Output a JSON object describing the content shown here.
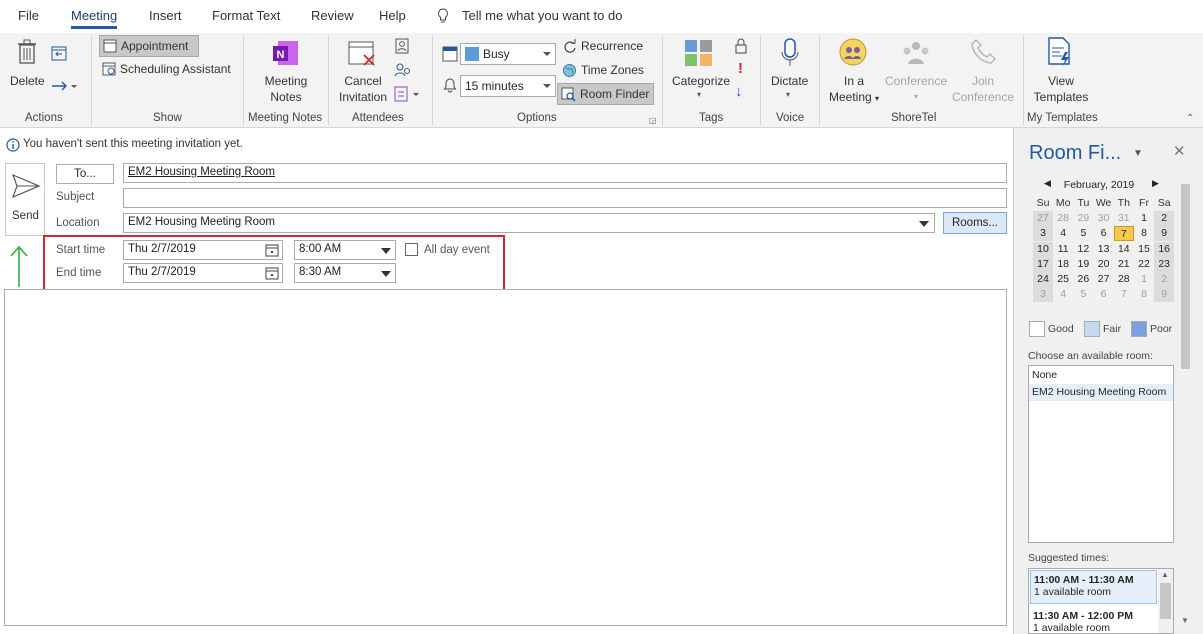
{
  "menu": {
    "tabs": [
      "File",
      "Meeting",
      "Insert",
      "Format Text",
      "Review",
      "Help"
    ],
    "active": "Meeting",
    "tell_me": "Tell me what you want to do"
  },
  "ribbon": {
    "actions": {
      "delete": "Delete",
      "group": "Actions"
    },
    "show": {
      "appointment": "Appointment",
      "scheduling": "Scheduling Assistant",
      "group": "Show"
    },
    "meeting_notes": {
      "line1": "Meeting",
      "line2": "Notes",
      "group": "Meeting Notes"
    },
    "attendees": {
      "line1": "Cancel",
      "line2": "Invitation",
      "group": "Attendees"
    },
    "options": {
      "show_as": "Busy",
      "reminder": "15 minutes",
      "recurrence": "Recurrence",
      "time_zones": "Time Zones",
      "room_finder": "Room Finder",
      "group": "Options"
    },
    "tags": {
      "categorize": "Categorize",
      "group": "Tags"
    },
    "voice": {
      "dictate": "Dictate",
      "group": "Voice"
    },
    "shoretel": {
      "in_a_1": "In a",
      "in_a_2": "Meeting",
      "conf_1": "Conference",
      "join_1": "Join",
      "join_2": "Conference",
      "group": "ShoreTel"
    },
    "templates": {
      "line1": "View",
      "line2": "Templates",
      "group": "My Templates"
    }
  },
  "form": {
    "info": "You haven't sent this meeting invitation yet.",
    "send": "Send",
    "to_button": "To...",
    "to_value": "EM2 Housing Meeting Room",
    "subject_label": "Subject",
    "subject_value": "",
    "location_label": "Location",
    "location_value": "EM2 Housing Meeting Room",
    "rooms_button": "Rooms...",
    "start_label": "Start time",
    "start_date": "Thu 2/7/2019",
    "start_time": "8:00 AM",
    "end_label": "End time",
    "end_date": "Thu 2/7/2019",
    "end_time": "8:30 AM",
    "all_day": "All day event"
  },
  "room_finder": {
    "title": "Room Fi...",
    "month": "February, 2019",
    "weekdays": [
      "Su",
      "Mo",
      "Tu",
      "We",
      "Th",
      "Fr",
      "Sa"
    ],
    "weeks": [
      [
        "27",
        "28",
        "29",
        "30",
        "31",
        "1",
        "2"
      ],
      [
        "3",
        "4",
        "5",
        "6",
        "7",
        "8",
        "9"
      ],
      [
        "10",
        "11",
        "12",
        "13",
        "14",
        "15",
        "16"
      ],
      [
        "17",
        "18",
        "19",
        "20",
        "21",
        "22",
        "23"
      ],
      [
        "24",
        "25",
        "26",
        "27",
        "28",
        "1",
        "2"
      ],
      [
        "3",
        "4",
        "5",
        "6",
        "7",
        "8",
        "9"
      ]
    ],
    "selected_day": "7",
    "legend": {
      "good": "Good",
      "fair": "Fair",
      "poor": "Poor"
    },
    "choose_label": "Choose an available room:",
    "rooms": [
      "None",
      "EM2 Housing Meeting Room"
    ],
    "suggested_label": "Suggested times:",
    "suggestions": [
      {
        "time": "11:00 AM - 11:30 AM",
        "detail": "1 available room"
      },
      {
        "time": "11:30 AM - 12:00 PM",
        "detail": "1 available room"
      }
    ]
  },
  "colors": {
    "accent": "#1e5aa8",
    "highlight_box": "#d9232d",
    "arrow": "#2db24a",
    "fair": "#c5d9f1",
    "poor": "#7aa1dd",
    "today": "#f6c94c"
  }
}
